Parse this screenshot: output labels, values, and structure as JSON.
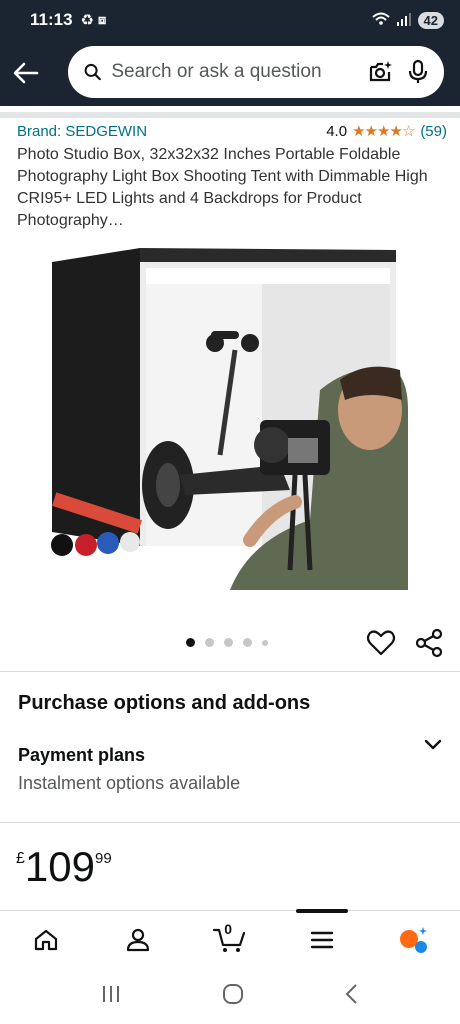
{
  "status": {
    "time": "11:13",
    "battery": "42"
  },
  "search": {
    "placeholder": "Search or ask a question"
  },
  "product": {
    "brand": "Brand: SEDGEWIN",
    "rating_value": "4.0",
    "stars": "★★★★☆",
    "review_count": "(59)",
    "title": "Photo Studio Box, 32x32x32 Inches Portable Foldable Photography Light Box Shooting Tent with Dimmable High CRI95+ LED Lights and 4 Backdrops for Product Photography…",
    "image_count": 5,
    "active_image": 1
  },
  "purchase": {
    "section_title": "Purchase options and add-ons",
    "payment_title": "Payment plans",
    "payment_sub": "Instalment options available"
  },
  "price": {
    "currency": "£",
    "whole": "109",
    "fraction": "99"
  },
  "cart": {
    "count": "0"
  },
  "colors": {
    "header_bg": "#1b2431",
    "link": "#007185",
    "star": "#de7921"
  }
}
